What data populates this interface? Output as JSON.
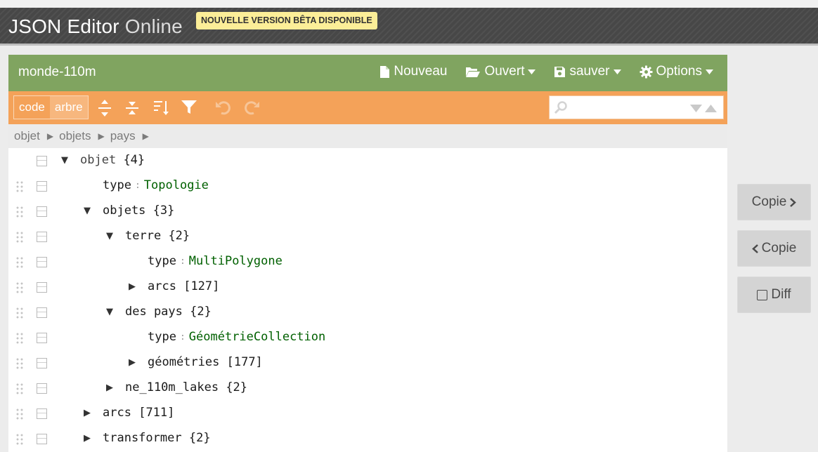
{
  "header": {
    "logo_main": "JSON Editor",
    "logo_light": "Online",
    "beta_badge": "NOUVELLE VERSION BÊTA DISPONIBLE"
  },
  "menubar": {
    "title": "monde-110m",
    "items": [
      {
        "label": "Nouveau",
        "icon": "file-icon",
        "dropdown": false
      },
      {
        "label": "Ouvert",
        "icon": "folder-open-icon",
        "dropdown": true
      },
      {
        "label": "sauver",
        "icon": "save-icon",
        "dropdown": true
      },
      {
        "label": "Options",
        "icon": "gear-icon",
        "dropdown": true
      }
    ]
  },
  "toolbar": {
    "modes": [
      "code",
      "arbre"
    ],
    "active_mode": "arbre",
    "icons": [
      "expand-all-icon",
      "collapse-all-icon",
      "sort-icon",
      "filter-icon",
      "undo-icon",
      "redo-icon"
    ],
    "search_value": "",
    "search_icon": "search-icon"
  },
  "breadcrumb": [
    "objet",
    "objets",
    "pays"
  ],
  "tree": [
    {
      "level": 0,
      "key": "objet",
      "count": "{4}",
      "expander": "open",
      "root": true
    },
    {
      "level": 1,
      "key": "type",
      "value": "Topologie"
    },
    {
      "level": 1,
      "key": "objets",
      "count": "{3}",
      "expander": "open"
    },
    {
      "level": 2,
      "key": "terre",
      "count": "{2}",
      "expander": "open"
    },
    {
      "level": 3,
      "key": "type",
      "value": "MultiPolygone"
    },
    {
      "level": 3,
      "key": "arcs",
      "count": "[127]",
      "expander": "closed"
    },
    {
      "level": 2,
      "key": "des pays",
      "count": "{2}",
      "expander": "open"
    },
    {
      "level": 3,
      "key": "type",
      "value": "GéométrieCollection"
    },
    {
      "level": 3,
      "key": "géométries",
      "count": "[177]",
      "expander": "closed"
    },
    {
      "level": 2,
      "key": "ne_110m_lakes",
      "count": "{2}",
      "expander": "closed"
    },
    {
      "level": 1,
      "key": "arcs",
      "count": "[711]",
      "expander": "closed"
    },
    {
      "level": 1,
      "key": "transformer",
      "count": "{2}",
      "expander": "closed"
    }
  ],
  "side_buttons": {
    "copy_right": "Copie",
    "copy_left": "Copie",
    "diff": "Diff"
  },
  "colors": {
    "menubar": "#80a460",
    "toolbar": "#f4a259",
    "value_string": "#006000",
    "beta_badge": "#fcee98"
  }
}
